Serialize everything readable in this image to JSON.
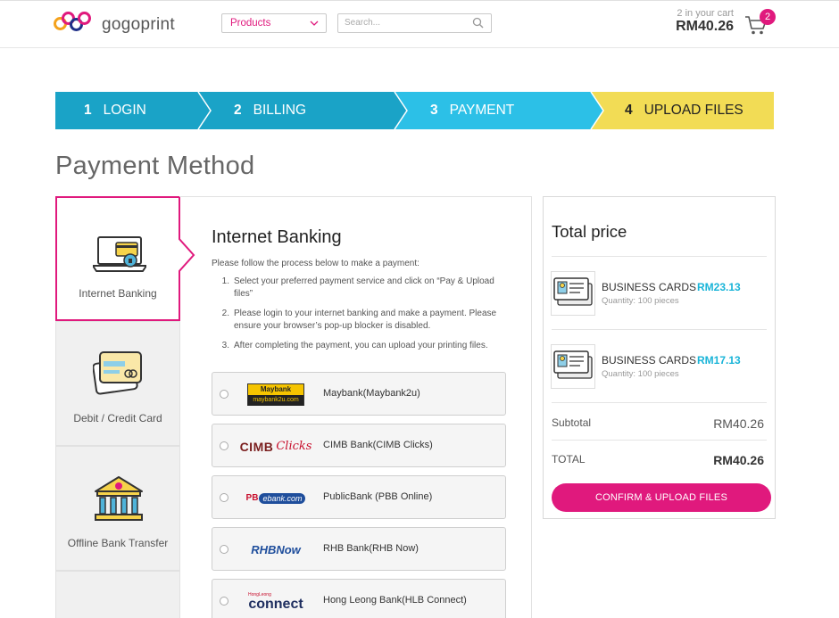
{
  "header": {
    "logo_text": "gogoprint",
    "products_label": "Products",
    "search_placeholder": "Search...",
    "cart_count_text": "2 in your cart",
    "cart_total": "RM40.26",
    "cart_badge": "2"
  },
  "steps": [
    {
      "num": "1",
      "label": "LOGIN",
      "color": "#1aa3c7"
    },
    {
      "num": "2",
      "label": "BILLING",
      "color": "#1aa3c7"
    },
    {
      "num": "3",
      "label": "PAYMENT",
      "color": "#2cc0e7"
    },
    {
      "num": "4",
      "label": "UPLOAD FILES",
      "color": "#f2dc55"
    }
  ],
  "page_title": "Payment Method",
  "methods": [
    {
      "label": "Internet Banking",
      "icon": "laptop-card-icon",
      "active": true
    },
    {
      "label": "Debit / Credit Card",
      "icon": "credit-card-icon",
      "active": false
    },
    {
      "label": "Offline Bank Transfer",
      "icon": "bank-building-icon",
      "active": false
    }
  ],
  "content": {
    "title": "Internet Banking",
    "intro": "Please follow the process below to make a payment:",
    "instructions": [
      {
        "n": "1.",
        "text": "Select your preferred payment service and click on “Pay & Upload files”"
      },
      {
        "n": "2.",
        "text": "Please login to your internet banking and make a payment. Please ensure your browser’s pop-up blocker is disabled."
      },
      {
        "n": "3.",
        "text": "After completing the payment, you can upload your printing files."
      }
    ],
    "banks": [
      {
        "name": "Maybank(Maybank2u)",
        "logo": "Maybank",
        "logo_sub": "maybank2u.com"
      },
      {
        "name": "CIMB Bank(CIMB Clicks)",
        "logo": "CIMB",
        "logo_sub": "Clicks"
      },
      {
        "name": "PublicBank (PBB Online)",
        "logo": "PB",
        "logo_sub": "ebank.com"
      },
      {
        "name": "RHB Bank(RHB Now)",
        "logo": "RHBNow"
      },
      {
        "name": "Hong Leong Bank(HLB Connect)",
        "logo": "connect",
        "logo_sub": "HongLeong"
      }
    ]
  },
  "total": {
    "title": "Total price",
    "items": [
      {
        "name": "BUSINESS CARDS",
        "qty": "Quantity: 100 pieces",
        "price": "RM23.13"
      },
      {
        "name": "BUSINESS CARDS",
        "qty": "Quantity: 100 pieces",
        "price": "RM17.13"
      }
    ],
    "subtotal_label": "Subtotal",
    "subtotal_value": "RM40.26",
    "total_label": "TOTAL",
    "total_value": "RM40.26",
    "confirm_label": "CONFIRM & UPLOAD FILES"
  },
  "colors": {
    "accent": "#e0197d",
    "price": "#19b4d8"
  }
}
